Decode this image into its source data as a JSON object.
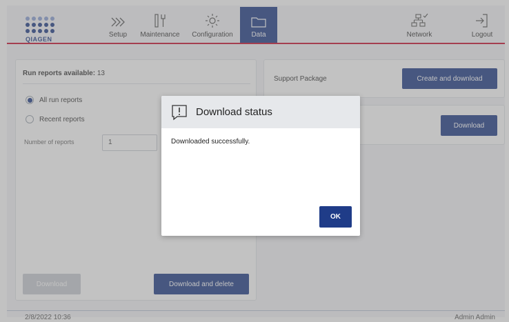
{
  "app": {
    "brand": "QIAGEN"
  },
  "nav": {
    "setup": "Setup",
    "maintenance": "Maintenance",
    "configuration": "Configuration",
    "data": "Data",
    "network": "Network",
    "logout": "Logout"
  },
  "left_panel": {
    "title": "Run reports available:",
    "count": "13",
    "radio_all": "All run reports",
    "radio_recent": "Recent reports",
    "number_label": "Number of reports",
    "number_value": "1",
    "selected_option": "All run reports",
    "download_button": "Download",
    "download_delete_button": "Download and delete"
  },
  "right_panel": {
    "support_label": "Support Package",
    "create_button": "Create and download",
    "download_button": "Download"
  },
  "footer": {
    "datetime": "2/8/2022 10:36",
    "user": "Admin Admin"
  },
  "dialog": {
    "title": "Download status",
    "message": "Downloaded successfully.",
    "ok_button": "OK",
    "icon": "message-alert-icon"
  },
  "colors": {
    "brand_blue": "#1f3c88",
    "brand_red": "#c8102e",
    "disabled": "#c9cdd3"
  }
}
